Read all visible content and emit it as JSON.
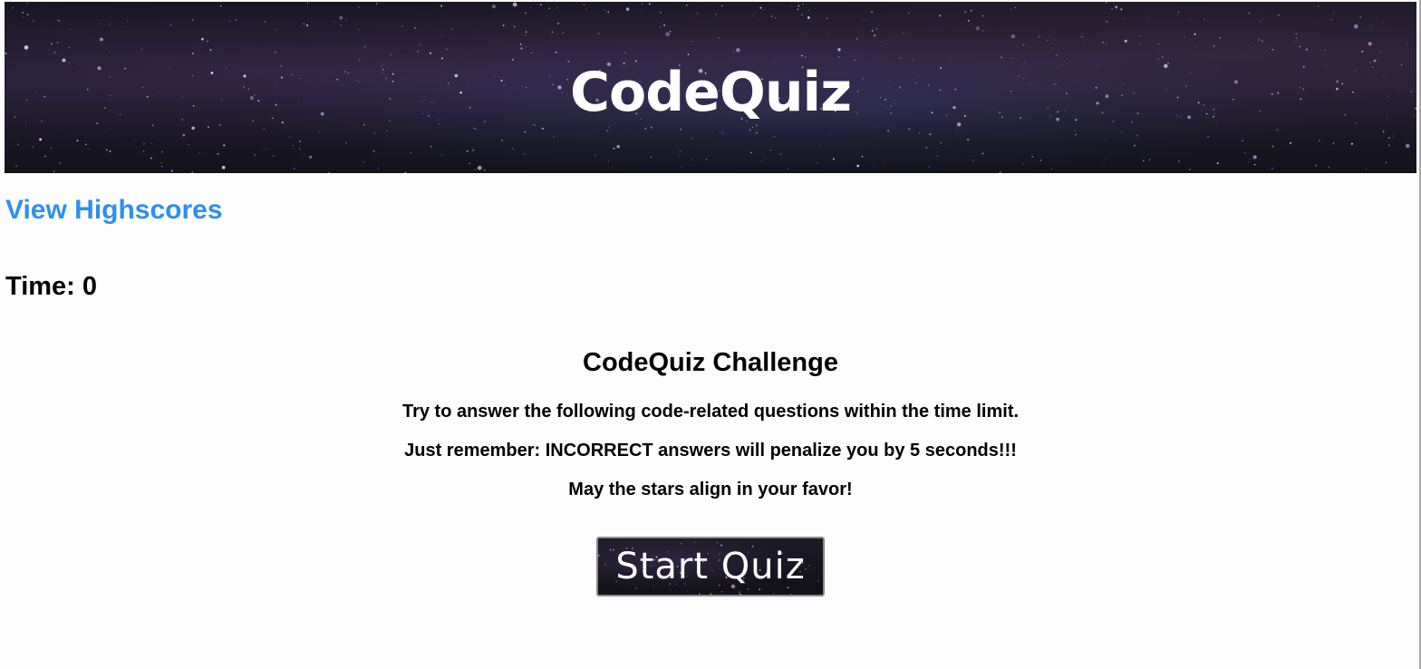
{
  "header": {
    "title": "CodeQuiz"
  },
  "nav": {
    "highscores_label": "View Highscores"
  },
  "timer": {
    "label": "Time: 0"
  },
  "intro": {
    "heading": "CodeQuiz Challenge",
    "lines": [
      "Try to answer the following code-related questions within the time limit.",
      "Just remember: INCORRECT answers will penalize you by 5 seconds!!!",
      "May the stars align in your favor!"
    ]
  },
  "actions": {
    "start_label": "Start Quiz"
  },
  "colors": {
    "link": "#2d8ff0",
    "text": "#000000",
    "background": "#fdfdfd",
    "header_bg": "#15141f"
  }
}
